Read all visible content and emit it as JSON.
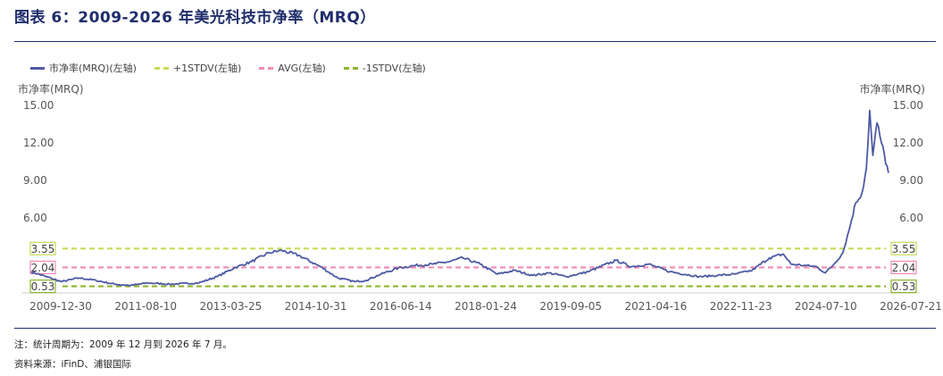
{
  "title": "图表 6：2009-2026 年美光科技市净率（MRQ）",
  "note": "注：统计周期为：2009 年 12 月到 2026 年 7 月。",
  "source": "资料来源：iFinD、浦银国际",
  "colors": {
    "pb_line": "#4d5aa3",
    "upper_band": "#c8dc57",
    "avg": "#f28ab6",
    "lower_band": "#8db62c",
    "title": "#1f2d6b"
  },
  "chart_data": {
    "type": "line",
    "title": "",
    "ylabel_left": "市净率(MRQ)",
    "ylabel_right": "市净率(MRQ)",
    "ylim": [
      0,
      15
    ],
    "y_ticks": [
      "15.00",
      "12.00",
      "9.00",
      "6.00"
    ],
    "x_ticks": [
      "2009-12-30",
      "2011-08-10",
      "2013-03-25",
      "2014-10-31",
      "2016-06-14",
      "2018-01-24",
      "2019-09-05",
      "2021-04-16",
      "2022-11-23",
      "2024-07-10",
      "2026-07-21"
    ],
    "legend_position": "top-left",
    "grid": false,
    "series": [
      {
        "name": "市净率(MRQ)(左轴)",
        "style": "solid",
        "x": [
          "2009-12-30",
          "2010-04-15",
          "2010-08-01",
          "2010-12-01",
          "2011-04-01",
          "2011-08-10",
          "2011-12-01",
          "2012-04-01",
          "2012-09-01",
          "2013-03-25",
          "2013-08-01",
          "2013-12-01",
          "2014-04-01",
          "2014-08-01",
          "2014-10-31",
          "2015-03-01",
          "2015-08-01",
          "2015-12-01",
          "2016-04-01",
          "2016-06-14",
          "2016-10-01",
          "2017-02-01",
          "2017-06-01",
          "2017-10-01",
          "2018-01-24",
          "2018-05-01",
          "2018-09-01",
          "2018-12-31",
          "2019-05-01",
          "2019-09-05",
          "2020-01-01",
          "2020-05-01",
          "2020-10-01",
          "2021-04-16",
          "2021-08-01",
          "2021-12-01",
          "2022-05-01",
          "2022-11-23",
          "2023-04-01",
          "2023-08-01",
          "2023-12-01",
          "2024-04-01",
          "2024-07-10",
          "2024-09-01",
          "2024-12-01",
          "2025-03-01",
          "2025-05-01",
          "2025-07-01",
          "2025-09-01",
          "2025-10-15",
          "2025-12-01",
          "2026-01-15",
          "2026-02-15",
          "2026-03-10",
          "2026-04-01",
          "2026-05-01",
          "2026-06-01",
          "2026-07-21"
        ],
        "values": [
          1.7,
          1.3,
          0.9,
          1.2,
          1.0,
          0.7,
          0.6,
          0.8,
          0.7,
          0.8,
          1.3,
          2.0,
          2.5,
          3.2,
          3.4,
          3.0,
          2.1,
          1.2,
          0.9,
          1.0,
          1.5,
          2.0,
          2.2,
          2.3,
          2.5,
          2.8,
          2.3,
          1.5,
          1.8,
          1.4,
          1.6,
          1.3,
          1.7,
          2.6,
          2.1,
          2.3,
          1.7,
          1.3,
          1.4,
          1.5,
          1.8,
          2.8,
          3.1,
          2.3,
          2.2,
          2.1,
          1.6,
          2.3,
          3.2,
          5.0,
          7.2,
          8.0,
          10.0,
          14.6,
          11.0,
          13.6,
          12.0,
          9.6
        ]
      },
      {
        "name": "+1STDV(左轴)",
        "style": "dashed",
        "value": 3.55
      },
      {
        "name": "AVG(左轴)",
        "style": "dashed",
        "value": 2.04
      },
      {
        "name": "-1STDV(左轴)",
        "style": "dashed",
        "value": 0.53
      }
    ],
    "band_labels": [
      "3.55",
      "2.04",
      "0.53"
    ]
  }
}
